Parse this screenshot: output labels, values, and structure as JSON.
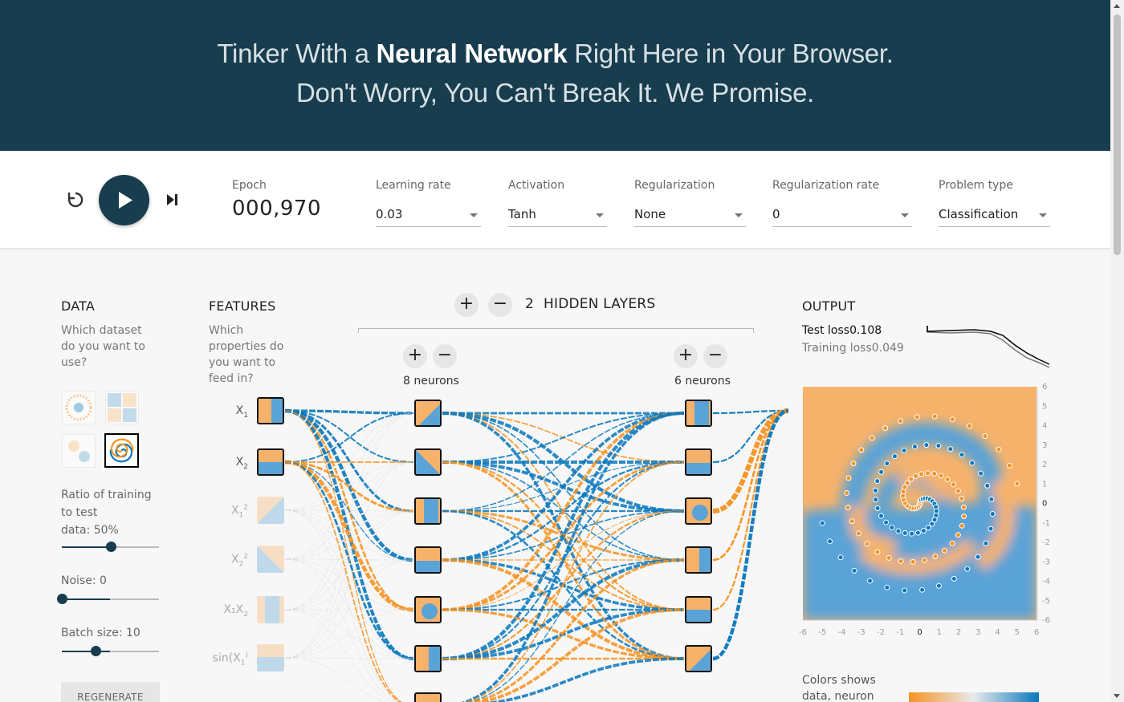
{
  "header": {
    "line1_pre": "Tinker With a ",
    "line1_bold": "Neural Network",
    "line1_post": " Right Here in Your Browser.",
    "line2": "Don't Worry, You Can't Break It. We Promise."
  },
  "controls": {
    "epoch_label": "Epoch",
    "epoch_value": "000,970",
    "learning_rate": {
      "label": "Learning rate",
      "value": "0.03"
    },
    "activation": {
      "label": "Activation",
      "value": "Tanh"
    },
    "regularization": {
      "label": "Regularization",
      "value": "None"
    },
    "regularization_rate": {
      "label": "Regularization rate",
      "value": "0"
    },
    "problem_type": {
      "label": "Problem type",
      "value": "Classification"
    }
  },
  "data_panel": {
    "title": "DATA",
    "subtitle_lines": [
      "Which dataset",
      "do you want to",
      "use?"
    ],
    "ratio_label_lines": [
      "Ratio of training",
      "to test"
    ],
    "ratio_line3": "data:  50%",
    "ratio_fraction": 0.5,
    "noise_label": "Noise:  0",
    "noise_fraction": 0.0,
    "batch_label": "Batch size:  10",
    "batch_fraction": 0.35,
    "regenerate": "REGENERATE",
    "selected_dataset": "spiral"
  },
  "features_panel": {
    "title": "FEATURES",
    "subtitle_lines": [
      "Which",
      "properties do",
      "you want to",
      "feed in?"
    ],
    "features": [
      {
        "main": "X",
        "sub": "1",
        "sup": "",
        "active": true
      },
      {
        "main": "X",
        "sub": "2",
        "sup": "",
        "active": true
      },
      {
        "main": "X",
        "sub": "1",
        "sup": "2",
        "active": false
      },
      {
        "main": "X",
        "sub": "2",
        "sup": "2",
        "active": false
      },
      {
        "main": "X₁X",
        "sub": "2",
        "sup": "",
        "active": false
      },
      {
        "main": "sin(X",
        "sub": "1",
        "sup": ")",
        "active": false
      }
    ]
  },
  "hidden_layers": {
    "count": "2",
    "label": "HIDDEN LAYERS",
    "layer1_neurons": "8 neurons",
    "layer2_neurons": "6 neurons",
    "plus": "+",
    "minus": "−"
  },
  "output_panel": {
    "title": "OUTPUT",
    "test_loss_label": "Test loss",
    "test_loss_value": "0.108",
    "training_loss_label": "Training loss",
    "training_loss_value": "0.049",
    "axis_ticks": [
      "-6",
      "-5",
      "-4",
      "-3",
      "-2",
      "-1",
      "0",
      "1",
      "2",
      "3",
      "4",
      "5",
      "6"
    ],
    "y_axis_ticks": [
      "6",
      "5",
      "4",
      "3",
      "2",
      "1",
      "0",
      "-1",
      "-2",
      "-3",
      "-4",
      "-5",
      "-6"
    ],
    "colors_line1": "Colors shows",
    "colors_line2": "data, neuron"
  },
  "colors": {
    "header_bg": "#183d4e",
    "orange": "#f59322",
    "blue": "#0877bd",
    "orange_light": "#f8c48b",
    "blue_light": "#5aa3d6"
  }
}
